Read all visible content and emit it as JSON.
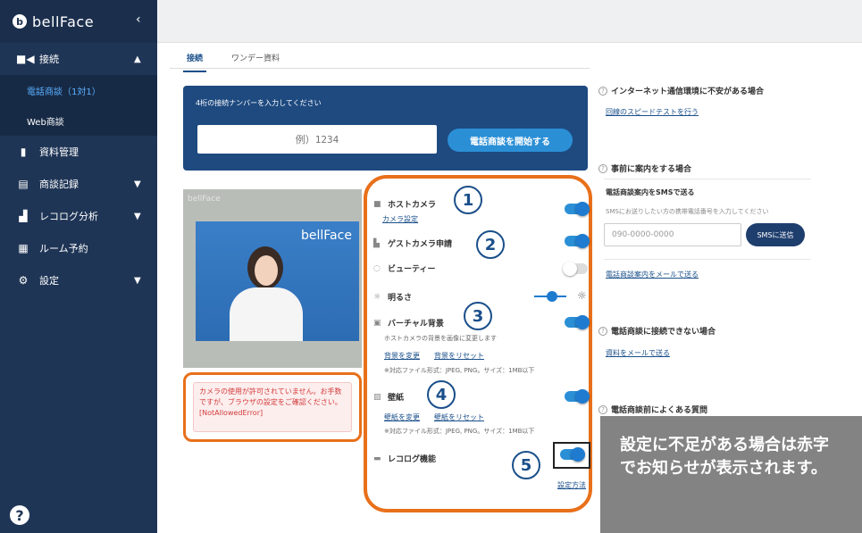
{
  "sidebar": {
    "brand": "bellFace",
    "items": [
      {
        "label": "接続",
        "icon": "video-icon",
        "chevron": "▲"
      },
      {
        "label": "電話商談（1対1）",
        "sub": true,
        "active": true
      },
      {
        "label": "Web商談",
        "sub": true
      },
      {
        "label": "資料管理",
        "icon": "document-icon"
      },
      {
        "label": "商談記録",
        "icon": "record-icon",
        "chevron": "▼"
      },
      {
        "label": "レコログ分析",
        "icon": "analytics-icon",
        "chevron": "▼"
      },
      {
        "label": "ルーム予約",
        "icon": "calendar-icon"
      },
      {
        "label": "設定",
        "icon": "settings-icon",
        "chevron": "▼"
      }
    ]
  },
  "tabs": [
    "接続",
    "ワンデー資料"
  ],
  "connect": {
    "label": "4桁の接続ナンバーを入力してください",
    "placeholder": "例）1234",
    "start_button": "電話商談を開始する"
  },
  "camera": {
    "brand": "bellFace"
  },
  "error": {
    "message": "カメラの使用が許可されていません。お手数ですが、ブラウザの設定をご確認ください。[NotAllowedError]"
  },
  "settings": {
    "host_camera": "ホストカメラ",
    "camera_settings_link": "カメラ設定",
    "guest_camera": "ゲストカメラ申請",
    "beauty": "ビューティー",
    "brightness": "明るさ",
    "virtual_bg": "バーチャル背景",
    "virtual_bg_note": "ホストカメラの背景を画像に変更します",
    "change_bg": "背景を変更",
    "reset_bg": "背景をリセット",
    "file_note": "※対応ファイル形式：JPEG, PNG。サイズ：1MB以下",
    "wallpaper": "壁紙",
    "change_wall": "壁紙を変更",
    "reset_wall": "壁紙をリセット",
    "recolog": "レコログ機能",
    "setup_method": "設定方法",
    "toggles": {
      "host_camera": true,
      "guest_camera": true,
      "beauty": false,
      "virtual_bg": true,
      "wallpaper": true,
      "recolog": true
    },
    "numbers": [
      "1",
      "2",
      "3",
      "4",
      "5"
    ]
  },
  "right": {
    "net_head": "インターネット通信環境に不安がある場合",
    "speedtest": "回線のスピードテストを行う",
    "pre_head": "事前に案内をする場合",
    "sms_title": "電話商談案内をSMSで送る",
    "sms_note": "SMSにお送りしたい方の携帯電話番号を入力してください",
    "phone_placeholder": "090-0000-0000",
    "sms_button": "SMSに送信",
    "mail_link": "電話商談案内をメールで送る",
    "cant_head": "電話商談に接続できない場合",
    "doc_mail": "資料をメールで送る",
    "faq_head": "電話商談前によくある質問"
  },
  "callout": "設定に不足がある場合は赤字でお知らせが表示されます。",
  "colors": {
    "accent": "#e8701a",
    "nav": "#1f3556",
    "primary": "#2b8fd6"
  }
}
